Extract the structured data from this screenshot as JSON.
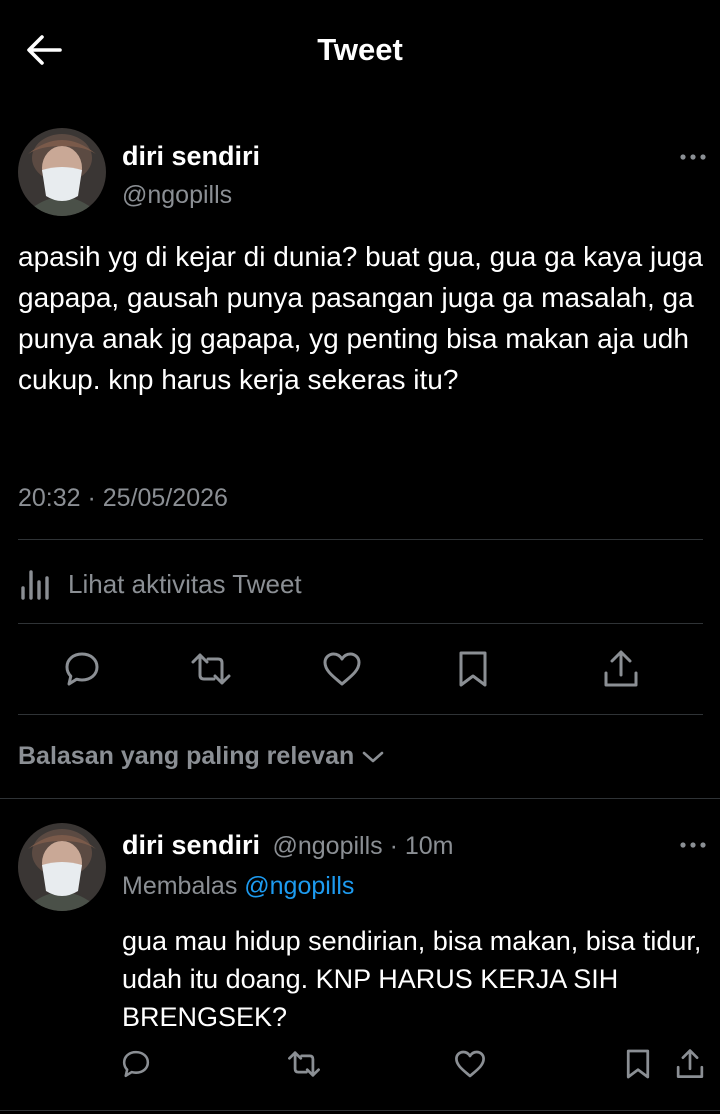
{
  "header": {
    "title": "Tweet"
  },
  "tweet": {
    "author_name": "diri sendiri",
    "author_handle": "@ngopills",
    "text": "apasih yg di kejar di dunia? buat gua, gua ga kaya juga gapapa, gausah punya pasangan juga ga masalah, ga punya anak jg gapapa, yg penting bisa makan aja udh cukup. knp harus kerja sekeras itu?",
    "timestamp": "20:32 · 25/05/2026",
    "activity_label": "Lihat aktivitas Tweet"
  },
  "replies_sort": {
    "label": "Balasan yang paling relevan"
  },
  "reply": {
    "author_name": "diri sendiri",
    "author_handle": "@ngopills",
    "separator": " · ",
    "time": "10m",
    "replying_prefix": "Membalas ",
    "replying_to": "@ngopills",
    "text": "gua mau hidup sendirian, bisa makan, bisa tidur, udah itu doang. KNP HARUS KERJA SIH BRENGSEK?"
  },
  "icons": {
    "back": "arrow-left-icon",
    "more": "more-horizontal-icon",
    "activity": "bar-chart-icon",
    "reply": "comment-icon",
    "retweet": "retweet-icon",
    "like": "heart-icon",
    "bookmark": "bookmark-icon",
    "share": "share-icon",
    "sort": "chevron-down-icon"
  },
  "colors": {
    "background": "#000000",
    "text": "#e7e9ea",
    "secondary": "#8b8f94",
    "link": "#1d9bf0",
    "divider": "#2f3336"
  }
}
